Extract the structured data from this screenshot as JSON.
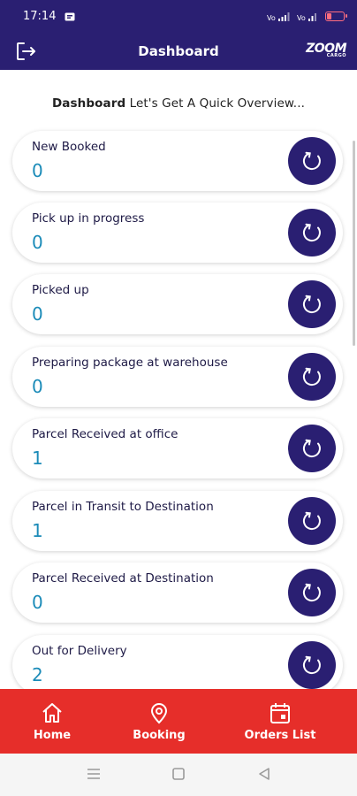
{
  "status_bar": {
    "time": "17:14",
    "network_left": "VoLTE",
    "network_right": "VoLTE"
  },
  "app_bar": {
    "title": "Dashboard",
    "logo_text": "ZOOM",
    "logo_subtext": "CARGO"
  },
  "subtitle": {
    "bold": "Dashboard",
    "rest": " Let's Get A Quick Overview..."
  },
  "cards": [
    {
      "label": "New Booked",
      "count": "0"
    },
    {
      "label": "Pick up in progress",
      "count": "0"
    },
    {
      "label": "Picked up",
      "count": "0"
    },
    {
      "label": "Preparing package at warehouse",
      "count": "0"
    },
    {
      "label": "Parcel Received at office",
      "count": "1"
    },
    {
      "label": "Parcel in Transit to Destination",
      "count": "1"
    },
    {
      "label": "Parcel Received at Destination",
      "count": "0"
    },
    {
      "label": "Out for Delivery",
      "count": "2"
    }
  ],
  "bottom_nav": {
    "home": "Home",
    "booking": "Booking",
    "orders_list": "Orders List"
  },
  "colors": {
    "primary": "#2a1f72",
    "accent": "#e62e2a",
    "count": "#1b8bb8"
  }
}
